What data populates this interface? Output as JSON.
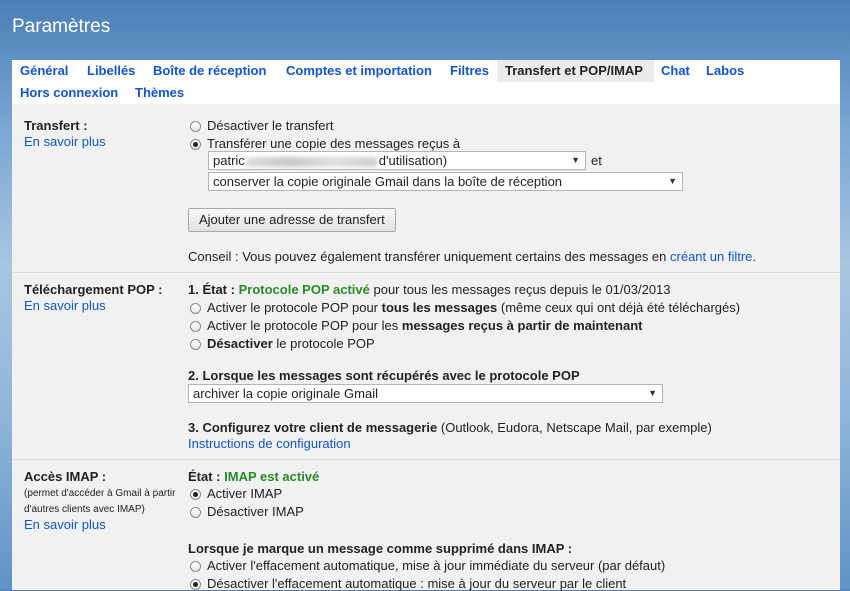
{
  "header": {
    "title": "Paramètres"
  },
  "tabs": [
    {
      "label": "Général"
    },
    {
      "label": "Libellés"
    },
    {
      "label": "Boîte de réception"
    },
    {
      "label": "Comptes et importation"
    },
    {
      "label": "Filtres"
    },
    {
      "label": "Transfert et POP/IMAP"
    },
    {
      "label": "Chat"
    },
    {
      "label": "Labos"
    },
    {
      "label": "Hors connexion"
    },
    {
      "label": "Thèmes"
    }
  ],
  "transfer": {
    "label": "Transfert :",
    "learn_more": "En savoir plus",
    "opt_disable": "Désactiver le transfert",
    "opt_forward": "Transférer une copie des messages reçus à",
    "address_prefix": "patric",
    "address_suffix": "d'utilisation)",
    "and": "et",
    "keep_option": "conserver la copie originale Gmail dans la boîte de réception",
    "add_button": "Ajouter une adresse de transfert",
    "tip": "Conseil : Vous pouvez également transférer uniquement certains des messages en",
    "tip_link": "créant un filtre",
    "tip_end": "."
  },
  "pop": {
    "label": "Téléchargement POP :",
    "learn_more": "En savoir plus",
    "status_prefix": "1. État :",
    "status_value": "Protocole POP activé",
    "status_suffix": "pour tous les messages reçus depuis le 01/03/2013",
    "opt1_a": "Activer le protocole POP pour",
    "opt1_b": "tous les messages",
    "opt1_c": "(même ceux qui ont déjà été téléchargés)",
    "opt2_a": "Activer le protocole POP pour les",
    "opt2_b": "messages reçus à partir de maintenant",
    "opt3_a": "Désactiver",
    "opt3_b": "le protocole POP",
    "when_heading": "2. Lorsque les messages sont récupérés avec le protocole POP",
    "when_option": "archiver la copie originale Gmail",
    "configure_bold": "3. Configurez votre client de messagerie",
    "configure_rest": "(Outlook, Eudora, Netscape Mail, par exemple)",
    "config_link": "Instructions de configuration"
  },
  "imap": {
    "label": "Accès IMAP :",
    "sub1": "(permet d'accéder à Gmail à partir",
    "sub2": "d'autres clients avec IMAP)",
    "learn_more": "En savoir plus",
    "status_prefix": "État :",
    "status_value": "IMAP est activé",
    "opt_enable": "Activer IMAP",
    "opt_disable": "Désactiver IMAP",
    "deleted_heading": "Lorsque je marque un message comme supprimé dans IMAP :",
    "del_opt1": "Activer l'effacement automatique, mise à jour immédiate du serveur (par défaut)",
    "del_opt2": "Désactiver l'effacement automatique : mise à jour du serveur par le client"
  }
}
